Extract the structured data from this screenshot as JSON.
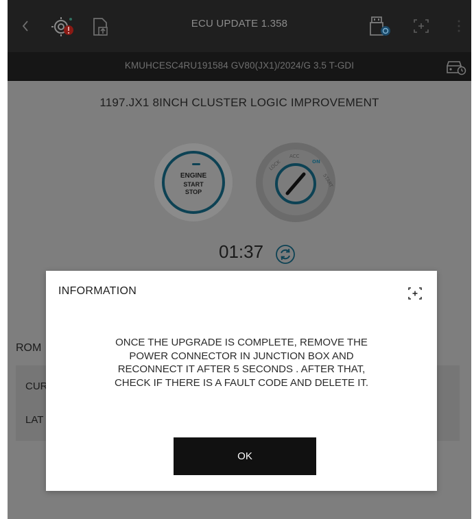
{
  "header": {
    "title": "ECU UPDATE 1.358",
    "icons": [
      "back-icon",
      "diagnostic-fault-icon",
      "file-upload-icon",
      "usb-device-icon",
      "expand-icon",
      "more-icon"
    ]
  },
  "vehicle_bar": {
    "vin_info": "KMUHCESC4RU191584  GV80(JX1)/2024/G 3.5 T-GDI",
    "icon": "vehicle-status-icon"
  },
  "content": {
    "heading": "1197.JX1 8INCH CLUSTER LOGIC IMPROVEMENT",
    "engine_button": {
      "line1": "ENGINE",
      "line2": "START",
      "line3": "STOP"
    },
    "ignition_key": {
      "labels": [
        "LOCK",
        "ACC",
        "ON",
        "START"
      ]
    },
    "timer": "01:37",
    "rom_label": "ROM",
    "rom_rows": [
      "CUR",
      "LAT"
    ]
  },
  "dialog": {
    "title": "INFORMATION",
    "message_lines": [
      "ONCE THE UPGRADE IS COMPLETE, REMOVE THE",
      "POWER CONNECTOR IN JUNCTION BOX AND",
      "RECONNECT IT AFTER 5 SECONDS . AFTER THAT,",
      "CHECK IF THERE IS A FAULT CODE AND DELETE IT."
    ],
    "ok_label": "OK"
  },
  "colors": {
    "overlay": "#7e7e7e",
    "header_bg": "#1f1f1f",
    "accent": "#0d4254",
    "fault_red": "#8a1a14",
    "button_bg": "#111111"
  }
}
